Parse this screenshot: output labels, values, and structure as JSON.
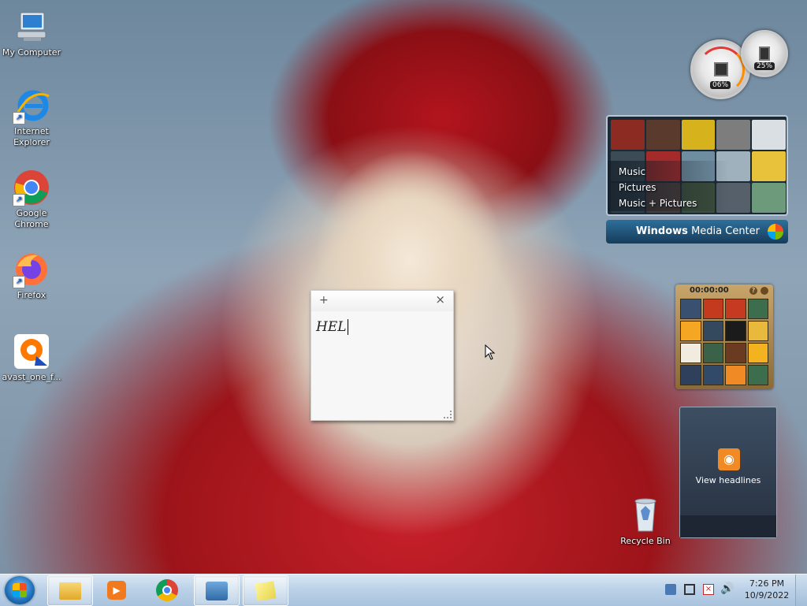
{
  "desktop": {
    "icons": [
      {
        "label": "My Computer"
      },
      {
        "label": "Internet Explorer"
      },
      {
        "label": "Google Chrome"
      },
      {
        "label": "Firefox"
      },
      {
        "label": "avast_one_f..."
      },
      {
        "label": "Recycle Bin"
      }
    ]
  },
  "sticky_note": {
    "text": "HEL",
    "add_glyph": "+",
    "close_glyph": "×"
  },
  "cpu_gadget": {
    "cpu_value": "06%",
    "memory_value": "25%"
  },
  "media_center": {
    "menu": [
      "Music",
      "Pictures",
      "Music + Pictures"
    ],
    "brand": "Windows Media Center",
    "brand_bold": "Windows",
    "brand_light": "Media Center"
  },
  "puzzle": {
    "timer": "00:00:00"
  },
  "feed": {
    "label": "View headlines"
  },
  "taskbar": {
    "time": "7:26 PM",
    "date": "10/9/2022"
  },
  "colors": {
    "taskbar_top": "#d9e6f3",
    "taskbar_bottom": "#a9c3de",
    "rss_orange": "#f08a24",
    "note_bg": "#f7f7f7"
  }
}
